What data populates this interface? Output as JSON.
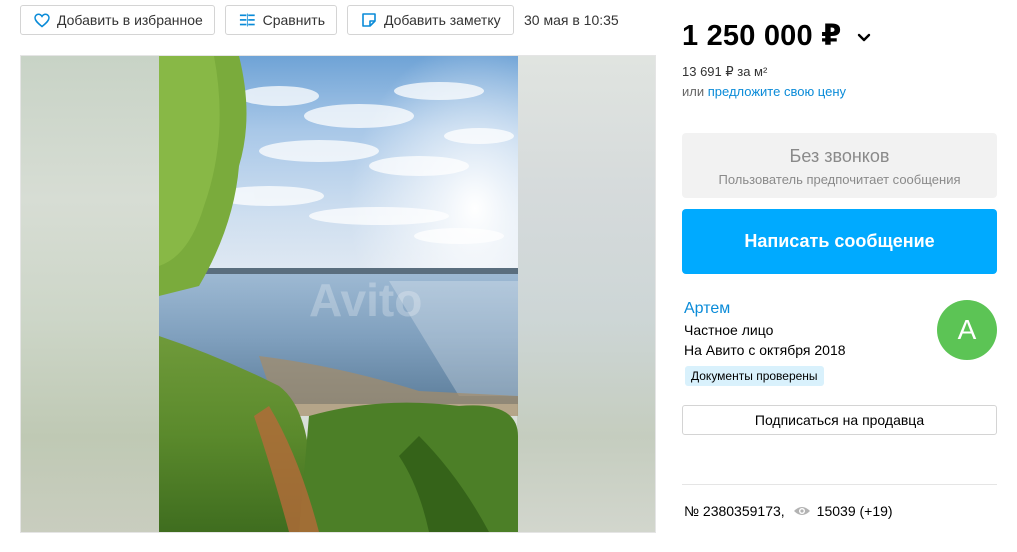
{
  "toolbar": {
    "favorite_label": "Добавить в избранное",
    "compare_label": "Сравнить",
    "note_label": "Добавить заметку",
    "date": "30 мая в 10:35"
  },
  "gallery": {
    "watermark": "Avito"
  },
  "price": {
    "amount": "1 250 000 ₽",
    "per_sqm": "13 691 ₽ за м²",
    "offer_prefix": "или ",
    "offer_link": "предложите свою цену"
  },
  "contact": {
    "no_calls_title": "Без звонков",
    "no_calls_sub": "Пользователь предпочитает сообщения",
    "write_button": "Написать сообщение"
  },
  "seller": {
    "name": "Артем",
    "type": "Частное лицо",
    "since": "На Авито с октября 2018",
    "badge": "Документы проверены",
    "avatar_letter": "А",
    "avatar_color": "#5cc455",
    "subscribe_button": "Подписаться на продавца"
  },
  "listing": {
    "number": "№ 2380359173,",
    "views": "15039 (+19)"
  },
  "colors": {
    "accent_blue": "#00aaff",
    "link_blue": "#0a8bd8"
  }
}
